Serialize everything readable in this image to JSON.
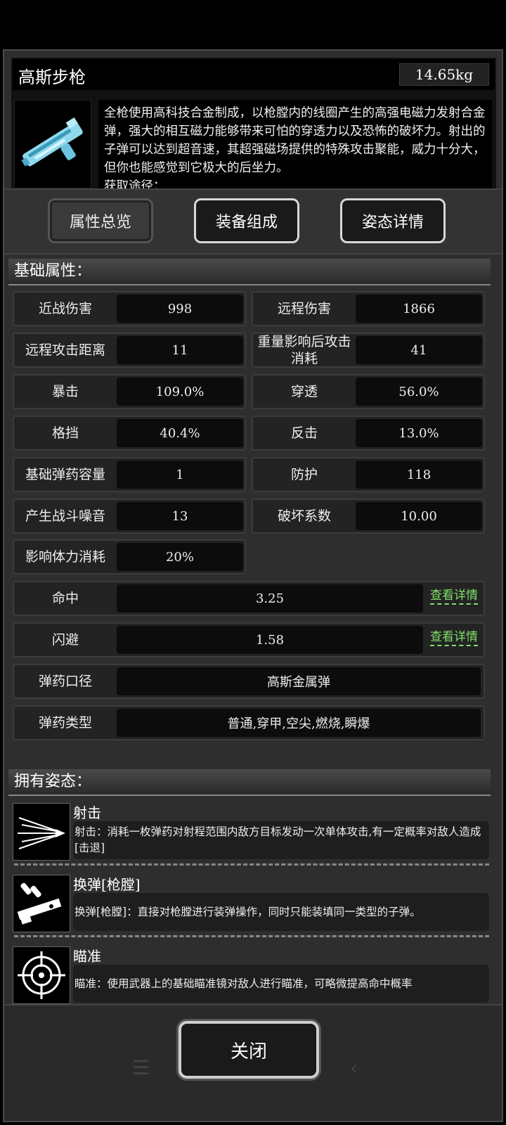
{
  "item": {
    "name": "高斯步枪",
    "weight": "14.65kg",
    "icon": "rifle-icon",
    "description": "全枪使用高科技合金制成，以枪膛内的线圈产生的高强电磁力发射合金弹，强大的相互磁力能够带来可怕的穿透力以及恐怖的破坏力。射出的子弹可以达到超音速，其超强磁场提供的特殊攻击聚能，威力十分大，但你也能感觉到它极大的后坐力。",
    "description_cut": "获取途径："
  },
  "tabs": [
    {
      "label": "属性总览",
      "active": true
    },
    {
      "label": "装备组成",
      "active": false
    },
    {
      "label": "姿态详情",
      "active": false
    }
  ],
  "base": {
    "heading": "基础属性：",
    "pairs": [
      {
        "l_label": "近战伤害",
        "l_value": "998",
        "r_label": "远程伤害",
        "r_value": "1866"
      },
      {
        "l_label": "远程攻击距离",
        "l_value": "11",
        "r_label": "重量影响后攻击消耗",
        "r_value": "41"
      },
      {
        "l_label": "暴击",
        "l_value": "109.0%",
        "r_label": "穿透",
        "r_value": "56.0%"
      },
      {
        "l_label": "格挡",
        "l_value": "40.4%",
        "r_label": "反击",
        "r_value": "13.0%"
      },
      {
        "l_label": "基础弹药容量",
        "l_value": "1",
        "r_label": "防护",
        "r_value": "118"
      },
      {
        "l_label": "产生战斗噪音",
        "l_value": "13",
        "r_label": "破坏系数",
        "r_value": "10.00"
      }
    ],
    "single": {
      "label": "影响体力消耗",
      "value": "20%"
    },
    "wide": [
      {
        "label": "命中",
        "value": "3.25",
        "link": "查看详情"
      },
      {
        "label": "闪避",
        "value": "1.58",
        "link": "查看详情"
      },
      {
        "label": "弹药口径",
        "value": "高斯金属弹"
      },
      {
        "label": "弹药类型",
        "value": "普通,穿甲,空尖,燃烧,瞬爆"
      }
    ]
  },
  "stances": {
    "heading": "拥有姿态：",
    "items": [
      {
        "name": "射击",
        "icon": "shoot-icon",
        "desc": "射击：消耗一枚弹药对射程范围内敌方目标发动一次单体攻击,有一定概率对敌人造成[击退]"
      },
      {
        "name": "换弹[枪膛]",
        "icon": "reload-icon",
        "desc": "换弹[枪膛]：直接对枪膛进行装弹操作，同时只能装填同一类型的子弹。"
      },
      {
        "name": "瞄准",
        "icon": "crosshair-icon",
        "desc": "瞄准：使用武器上的基础瞄准镜对敌人进行瞄准，可略微提高命中概率"
      }
    ]
  },
  "close_label": "关闭"
}
